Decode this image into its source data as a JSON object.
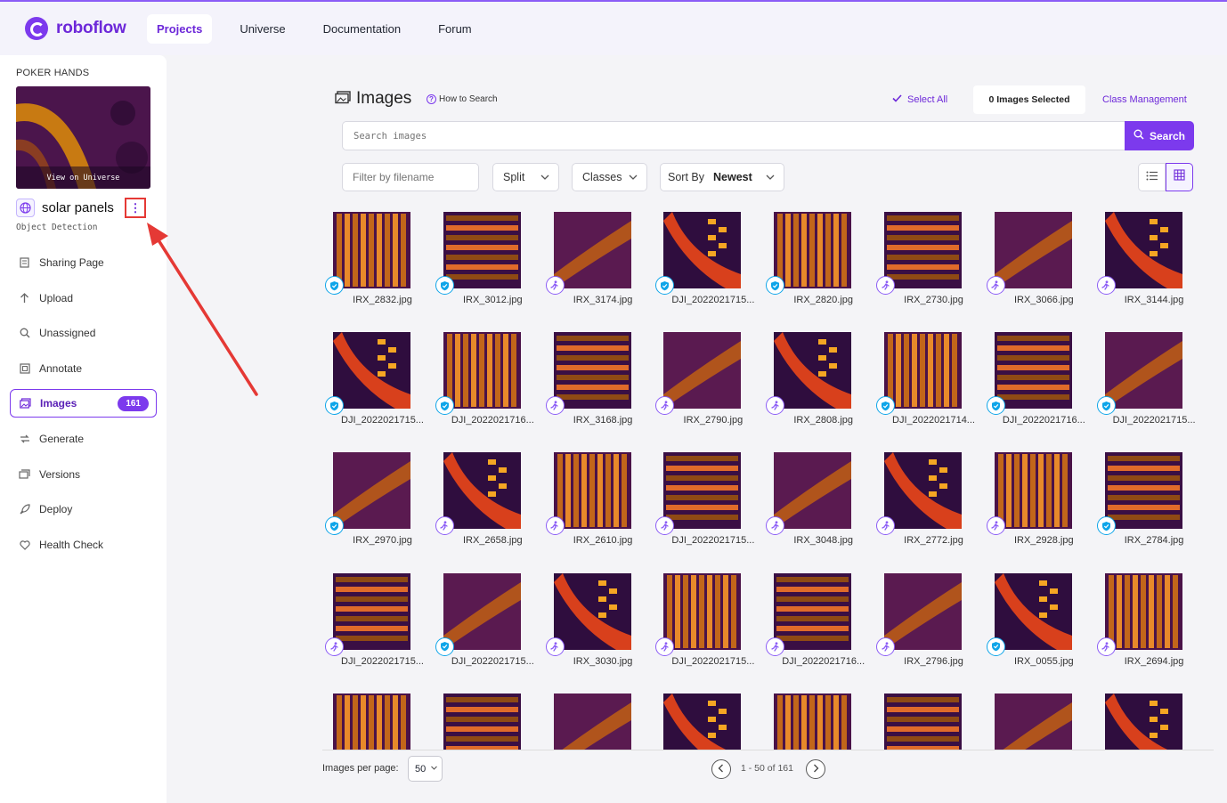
{
  "nav": {
    "brand": "roboflow",
    "tabs": [
      {
        "label": "Projects",
        "active": true
      },
      {
        "label": "Universe",
        "active": false
      },
      {
        "label": "Documentation",
        "active": false
      },
      {
        "label": "Forum",
        "active": false
      }
    ]
  },
  "sidebar": {
    "workspace": "POKER HANDS",
    "universe_label": "View on Universe",
    "project_name": "solar panels",
    "project_type": "Object Detection",
    "items": [
      {
        "label": "Sharing Page",
        "icon": "document-icon"
      },
      {
        "label": "Upload",
        "icon": "upload-arrow-icon"
      },
      {
        "label": "Unassigned",
        "icon": "search-icon"
      },
      {
        "label": "Annotate",
        "icon": "annotate-icon"
      },
      {
        "label": "Images",
        "icon": "images-icon",
        "active": true,
        "badge": "161"
      },
      {
        "label": "Generate",
        "icon": "generate-icon"
      },
      {
        "label": "Versions",
        "icon": "versions-icon"
      },
      {
        "label": "Deploy",
        "icon": "rocket-icon"
      },
      {
        "label": "Health Check",
        "icon": "heart-icon"
      }
    ]
  },
  "main": {
    "title": "Images",
    "how_to": "How to Search",
    "select_all": "Select All",
    "selected_count": "0 Images Selected",
    "class_mgmt": "Class Management",
    "search_placeholder": "Search images",
    "search_button": "Search",
    "filter_placeholder": "Filter by filename",
    "split_label": "Split",
    "classes_label": "Classes",
    "sort_label": "Sort By",
    "sort_value": "Newest"
  },
  "images": [
    {
      "name": "IRX_2832.jpg",
      "status": "annotated"
    },
    {
      "name": "IRX_3012.jpg",
      "status": "annotated"
    },
    {
      "name": "IRX_3174.jpg",
      "status": "unannotated"
    },
    {
      "name": "DJI_2022021715...",
      "status": "annotated"
    },
    {
      "name": "IRX_2820.jpg",
      "status": "annotated"
    },
    {
      "name": "IRX_2730.jpg",
      "status": "unannotated"
    },
    {
      "name": "IRX_3066.jpg",
      "status": "unannotated"
    },
    {
      "name": "IRX_3144.jpg",
      "status": "unannotated"
    },
    {
      "name": "DJI_2022021715...",
      "status": "annotated"
    },
    {
      "name": "DJI_2022021716...",
      "status": "annotated"
    },
    {
      "name": "IRX_3168.jpg",
      "status": "unannotated"
    },
    {
      "name": "IRX_2790.jpg",
      "status": "unannotated"
    },
    {
      "name": "IRX_2808.jpg",
      "status": "unannotated"
    },
    {
      "name": "DJI_2022021714...",
      "status": "annotated"
    },
    {
      "name": "DJI_2022021716...",
      "status": "annotated"
    },
    {
      "name": "DJI_2022021715...",
      "status": "annotated"
    },
    {
      "name": "IRX_2970.jpg",
      "status": "annotated"
    },
    {
      "name": "IRX_2658.jpg",
      "status": "unannotated"
    },
    {
      "name": "IRX_2610.jpg",
      "status": "unannotated"
    },
    {
      "name": "DJI_2022021715...",
      "status": "unannotated"
    },
    {
      "name": "IRX_3048.jpg",
      "status": "unannotated"
    },
    {
      "name": "IRX_2772.jpg",
      "status": "unannotated"
    },
    {
      "name": "IRX_2928.jpg",
      "status": "unannotated"
    },
    {
      "name": "IRX_2784.jpg",
      "status": "annotated"
    },
    {
      "name": "DJI_2022021715...",
      "status": "unannotated"
    },
    {
      "name": "DJI_2022021715...",
      "status": "annotated"
    },
    {
      "name": "IRX_3030.jpg",
      "status": "unannotated"
    },
    {
      "name": "DJI_2022021715...",
      "status": "unannotated"
    },
    {
      "name": "DJI_2022021716...",
      "status": "unannotated"
    },
    {
      "name": "IRX_2796.jpg",
      "status": "unannotated"
    },
    {
      "name": "IRX_0055.jpg",
      "status": "annotated"
    },
    {
      "name": "IRX_2694.jpg",
      "status": "unannotated"
    },
    {
      "name": "",
      "status": ""
    },
    {
      "name": "",
      "status": ""
    },
    {
      "name": "",
      "status": ""
    },
    {
      "name": "",
      "status": ""
    },
    {
      "name": "",
      "status": ""
    },
    {
      "name": "",
      "status": ""
    },
    {
      "name": "",
      "status": ""
    },
    {
      "name": "",
      "status": ""
    }
  ],
  "footer": {
    "per_page_label": "Images per page:",
    "per_page_value": "50",
    "range": "1 - 50 of 161"
  },
  "colors": {
    "accent": "#7c3aed",
    "annotated": "#0ea5e9",
    "unannotated": "#8b5cf6",
    "annotation_arrow": "#e53935"
  }
}
